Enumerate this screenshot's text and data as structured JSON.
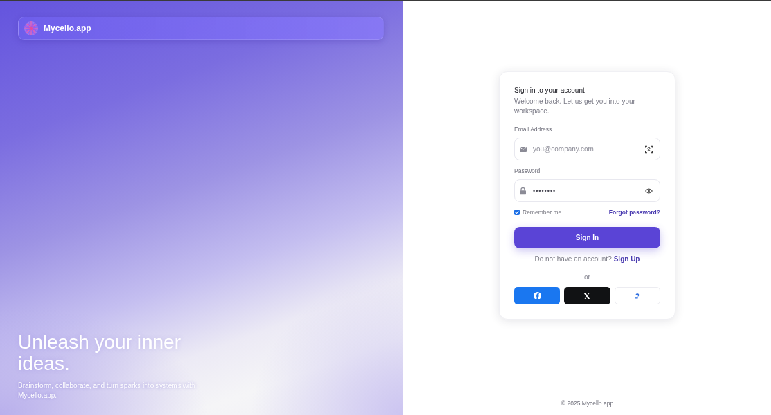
{
  "brand": {
    "name": "Mycello.app"
  },
  "hero": {
    "headline": "Unleash your inner ideas.",
    "tagline": "Brainstorm, collaborate, and turn sparks into systems with Mycello.app."
  },
  "signin": {
    "title": "Sign in to your account",
    "subtitle": "Welcome back. Let us get you into your workspace.",
    "fields": [
      {
        "kind": "email",
        "label": "Email Address",
        "placeholder": "you@company.com"
      },
      {
        "kind": "password",
        "label": "Password",
        "value": "••••••••"
      }
    ],
    "remember": {
      "label": "Remember me",
      "checked": true
    },
    "forgot_link": "Forgot password?",
    "submit": "Sign In",
    "signup_prompt": "Do not have an account?",
    "signup_link": "Sign Up",
    "divider": "or",
    "social_buttons": [
      {
        "kind": "facebook"
      },
      {
        "kind": "x"
      },
      {
        "kind": "partial"
      }
    ]
  },
  "footer": "© 2025 Mycello.app"
}
